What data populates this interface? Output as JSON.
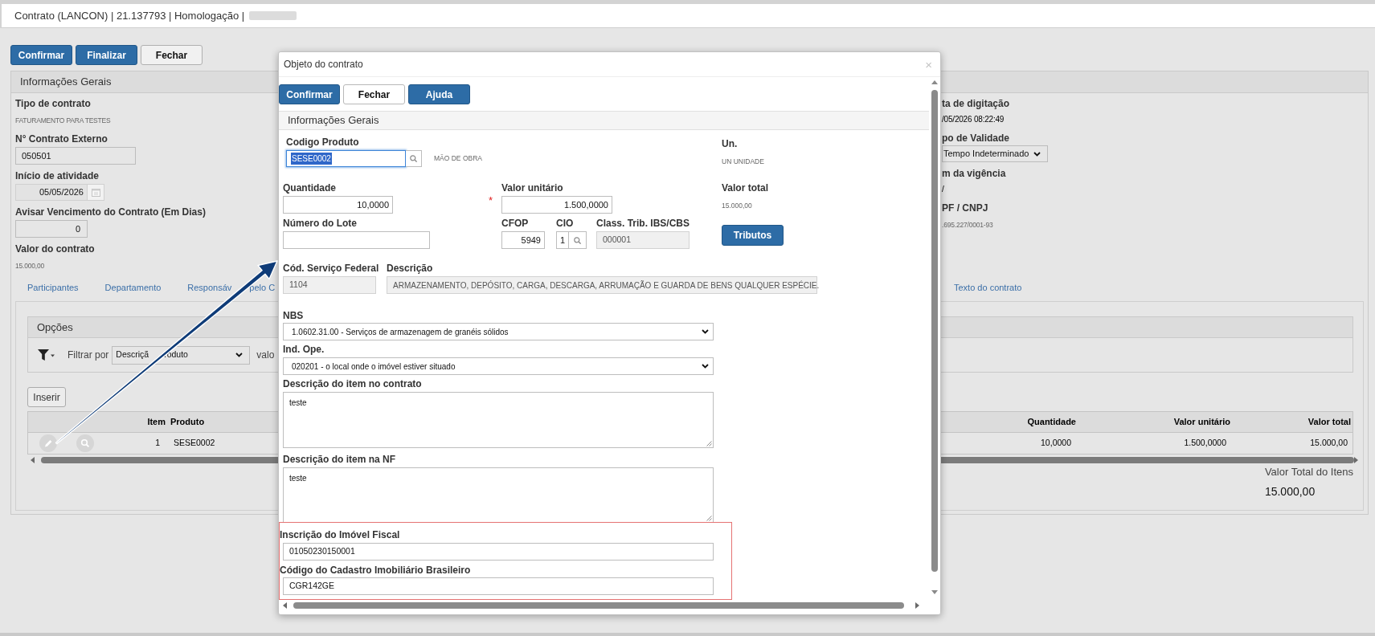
{
  "window": {
    "title": "Contrato (LANCON) | 21.137793 | Homologação |"
  },
  "toolbar": [
    {
      "label": "Confirmar",
      "kind": "primary"
    },
    {
      "label": "Finalizar",
      "kind": "primary"
    },
    {
      "label": "Fechar",
      "kind": "default"
    }
  ],
  "general_info": {
    "title": "Informações Gerais",
    "left_fields": [
      {
        "label": "Tipo de contrato",
        "kind": "text",
        "value": "FATURAMENTO PARA TESTES"
      },
      {
        "label": "N° Contrato Externo",
        "kind": "input",
        "value": "050501"
      },
      {
        "label": "Início de atividade",
        "kind": "date",
        "value": "05/05/2026"
      },
      {
        "label": "Avisar Vencimento do Contrato (Em Dias)",
        "kind": "number",
        "value": "0"
      },
      {
        "label": "Valor do contrato",
        "kind": "text",
        "value": "15.000,00"
      }
    ],
    "right_fields": [
      {
        "label": "ta de digitação",
        "kind": "strong",
        "value": "/05/2026 08:22:49"
      },
      {
        "label": "po de Validade",
        "kind": "select",
        "value": "Tempo Indeterminado"
      },
      {
        "label": "m da vigência",
        "kind": "strong",
        "value": "/"
      },
      {
        "label": "PF / CNPJ",
        "kind": "text",
        "value": ".695.227/0001-93"
      }
    ]
  },
  "tabs": [
    {
      "label": "Participantes"
    },
    {
      "label": "Departamento"
    },
    {
      "label_parts": [
        "Responsáv",
        "pelo C"
      ]
    },
    {
      "label": "Texto do contrato"
    }
  ],
  "options": {
    "title": "Opções",
    "filter_label": "Filtrar por",
    "filter_field_parts": [
      "Descriçã",
      "roduto"
    ],
    "value_label": "valo"
  },
  "insert_button": "Inserir",
  "items_table": {
    "columns": [
      "Item",
      "Produto",
      "Quantidade",
      "Valor unitário",
      "Valor total"
    ],
    "rows": [
      {
        "cells": [
          "1",
          "SESE0002",
          "10,0000",
          "1.500,0000",
          "15.000,00"
        ]
      }
    ]
  },
  "items_total": {
    "label": "Valor Total do Itens",
    "value": "15.000,00"
  },
  "dialog": {
    "title": "Objeto do contrato",
    "close": "×",
    "buttons": [
      {
        "label": "Confirmar",
        "kind": "primary"
      },
      {
        "label": "Fechar",
        "kind": "default"
      },
      {
        "label": "Ajuda",
        "kind": "primary"
      }
    ],
    "section_title": "Informações Gerais",
    "product_code": {
      "label": "Codigo Produto",
      "value": "SESE0002",
      "focused": true,
      "product_name": "MÃO DE OBRA"
    },
    "unit": {
      "label": "Un.",
      "value": "UN UNIDADE"
    },
    "quantity": {
      "label": "Quantidade",
      "value": "10,0000"
    },
    "unit_price": {
      "label": "Valor unitário",
      "value": "1.500,0000",
      "required_mark": "*"
    },
    "total_value": {
      "label": "Valor total",
      "value": "15.000,00"
    },
    "lot_number": {
      "label": "Número do Lote"
    },
    "cfop": {
      "label": "CFOP",
      "value": "5949"
    },
    "cio": {
      "label": "CIO",
      "value": "1"
    },
    "tax_class": {
      "label": "Class. Trib. IBS/CBS",
      "value": "000001",
      "readonly": true
    },
    "taxes_button": "Tributos",
    "federal_service_code": {
      "label": "Cód. Serviço Federal",
      "value": "1104",
      "readonly": true
    },
    "service_description": {
      "label": "Descrição",
      "value": "ARMAZENAMENTO, DEPÓSITO, CARGA, DESCARGA, ARRUMAÇÃO E GUARDA DE BENS QUALQUER ESPÉCIE.",
      "readonly": true
    },
    "nbs": {
      "label": "NBS",
      "value": "1.0602.31.00 - Serviços de armazenagem de granéis sólidos"
    },
    "operation_indicator": {
      "label": "Ind. Ope.",
      "value": "020201 - o local onde o imóvel estiver situado"
    },
    "contract_item_description": {
      "label": "Descrição do item no contrato",
      "value": "teste"
    },
    "invoice_item_description": {
      "label": "Descrição do item na NF",
      "value": "teste"
    },
    "property_registration": {
      "label": "Inscrição do Imóvel Fiscal",
      "value": "01050230150001"
    },
    "real_estate_code": {
      "label": "Código do Cadastro Imobiliário Brasileiro",
      "value": "CGR142GE"
    }
  }
}
